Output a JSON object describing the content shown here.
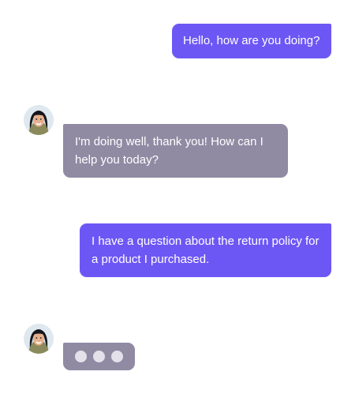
{
  "messages": [
    {
      "sender": "user",
      "text": "Hello, how are you doing?"
    },
    {
      "sender": "agent",
      "text": "I'm doing well, thank you! How can I help you today?"
    },
    {
      "sender": "user",
      "text": "I have a question about the return policy for a product I purchased."
    }
  ],
  "typing_indicator": {
    "dots": 3
  },
  "avatar_icon": "agent-avatar-icon",
  "colors": {
    "outgoing_bubble": "#6c57f5",
    "incoming_bubble": "#918aa3",
    "dot": "#e4e1ea",
    "background": "#ffffff"
  }
}
